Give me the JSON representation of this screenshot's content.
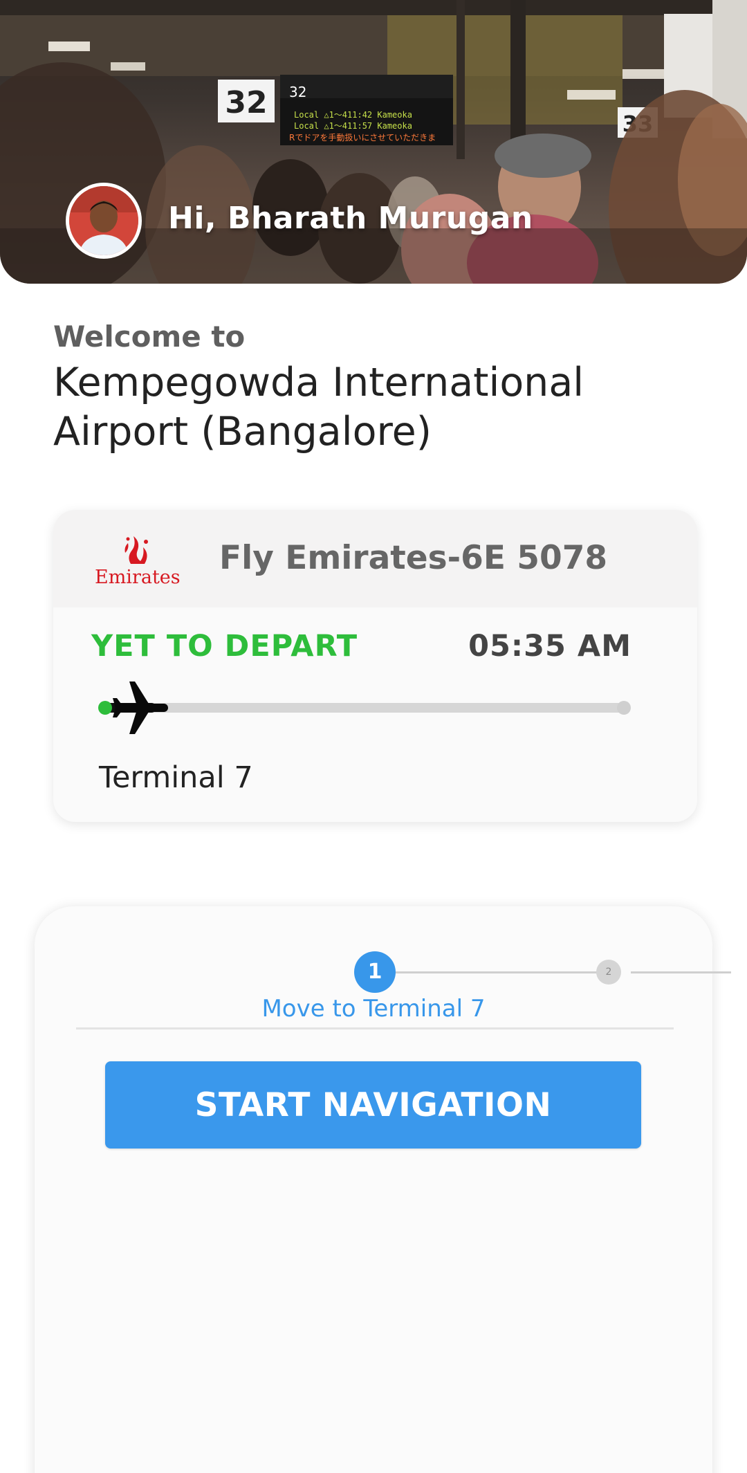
{
  "header": {
    "greeting": "Hi, Bharath Murugan",
    "sign_numbers": [
      "32",
      "32",
      "33"
    ],
    "board_lines": [
      "Local  △1〜411:42  Kameoka",
      "Local  △1〜411:57  Kameoka",
      "Rでドアを手動扱いにさせていただきま"
    ]
  },
  "welcome": {
    "subtitle": "Welcome to",
    "airport_name": "Kempegowda International Airport (Bangalore)"
  },
  "flight": {
    "airline_logo_text": "Emirates",
    "name": "Fly Emirates-6E 5078",
    "status": "YET TO DEPART",
    "time": "05:35 AM",
    "terminal": "Terminal 7",
    "progress_fraction": 0.1,
    "status_color": "#2ebd3b",
    "brand_color": "#d71921",
    "plane_icon": "airplane-icon"
  },
  "navigation": {
    "steps": [
      {
        "number": "1",
        "active": true
      },
      {
        "number": "2",
        "active": false
      }
    ],
    "current_step_label": "Move to Terminal 7",
    "button_label": "START NAVIGATION",
    "accent_color": "#3a98ec"
  }
}
